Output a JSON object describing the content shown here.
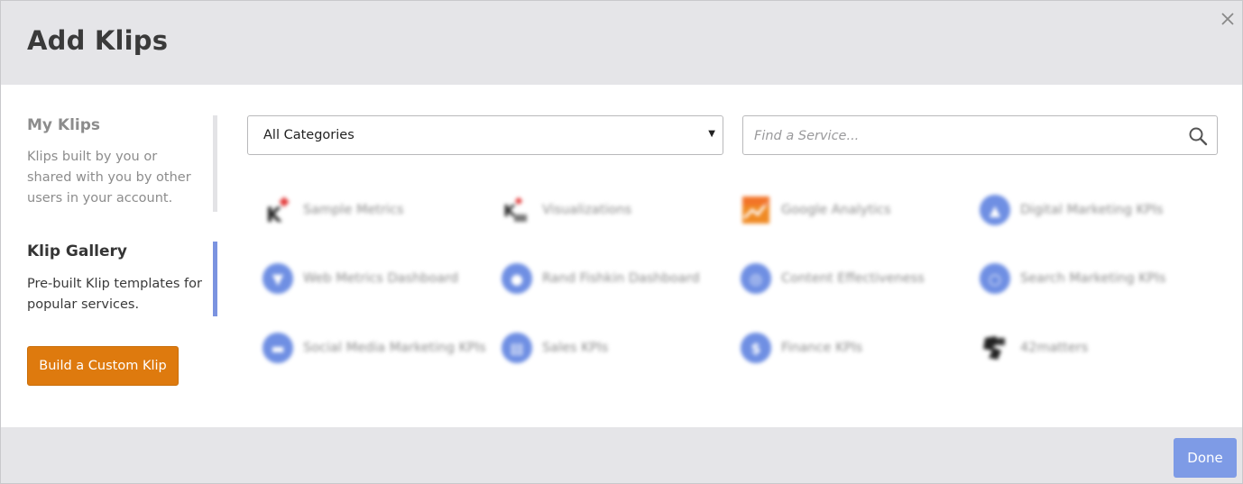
{
  "dialog": {
    "title": "Add Klips",
    "close_icon": "close-icon"
  },
  "sidebar": {
    "my_klips": {
      "heading": "My Klips",
      "description": "Klips built by you or shared with you by other users in your account."
    },
    "klip_gallery": {
      "heading": "Klip Gallery",
      "description": "Pre-built Klip templates for popular services.",
      "active": true
    },
    "build_button_label": "Build a Custom Klip"
  },
  "filters": {
    "category_selected": "All Categories",
    "search_placeholder": "Find a Service..."
  },
  "gallery": {
    "items": [
      {
        "label": "Sample Metrics",
        "icon": "klipfolio-logo-icon"
      },
      {
        "label": "Visualizations",
        "icon": "klipfolio-viz-icon"
      },
      {
        "label": "Google Analytics",
        "icon": "google-analytics-icon"
      },
      {
        "label": "Digital Marketing KPIs",
        "icon": "chart-circle-icon"
      },
      {
        "label": "Web Metrics Dashboard",
        "icon": "funnel-circle-icon"
      },
      {
        "label": "Rand Fishkin Dashboard",
        "icon": "person-circle-icon"
      },
      {
        "label": "Content Effectiveness",
        "icon": "target-circle-icon"
      },
      {
        "label": "Search Marketing KPIs",
        "icon": "search-circle-icon"
      },
      {
        "label": "Social Media Marketing KPIs",
        "icon": "social-circle-icon"
      },
      {
        "label": "Sales KPIs",
        "icon": "document-circle-icon"
      },
      {
        "label": "Finance KPIs",
        "icon": "dollar-circle-icon"
      },
      {
        "label": "42matters",
        "icon": "42matters-logo-icon"
      }
    ]
  },
  "footer": {
    "done_label": "Done"
  },
  "colors": {
    "accent_orange": "#de7a0e",
    "accent_blue": "#7e9be6",
    "active_indicator": "#7b93e0",
    "header_bg": "#e5e5e8"
  }
}
